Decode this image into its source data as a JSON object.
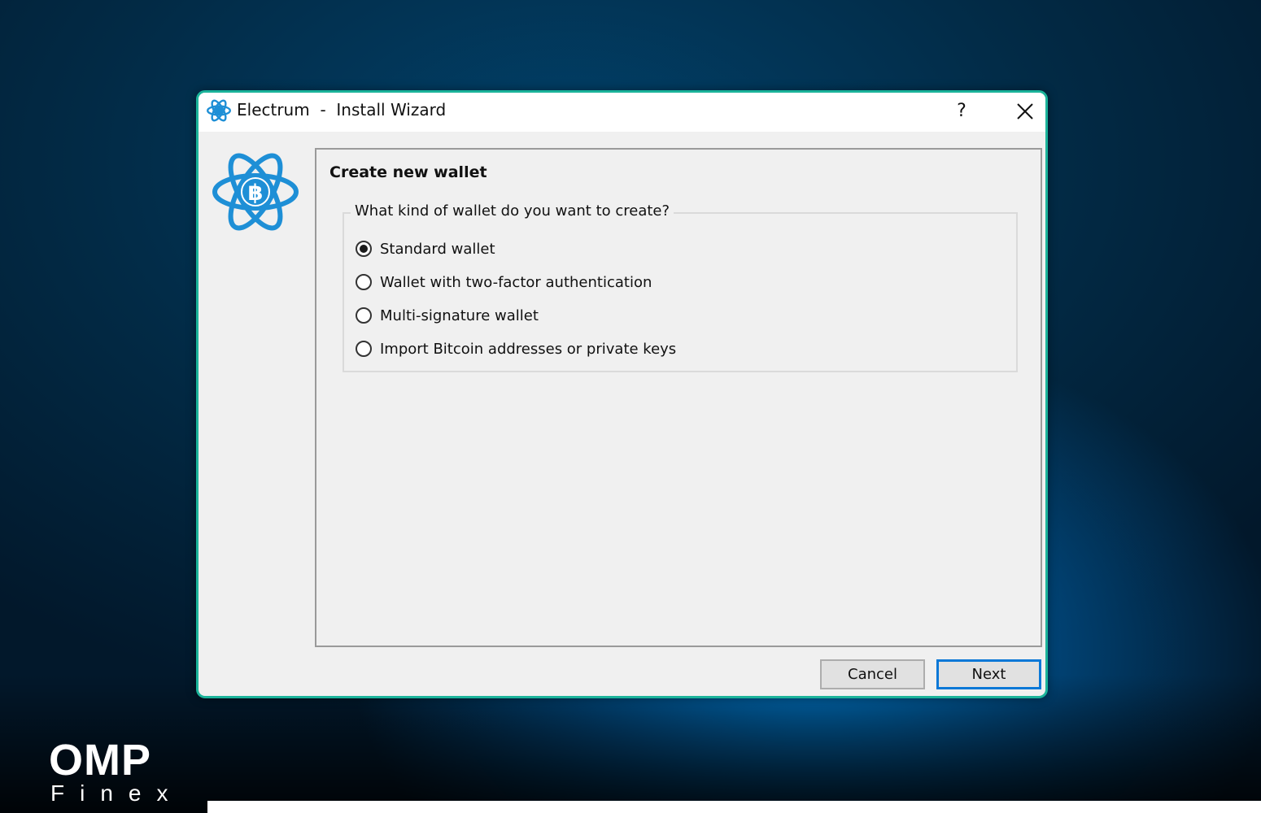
{
  "window": {
    "app_name": "Electrum",
    "separator": "-",
    "title": "Install Wizard",
    "help_label": "?"
  },
  "panel": {
    "title": "Create new wallet",
    "question": "What kind of wallet do you want to create?",
    "options": [
      {
        "label": "Standard wallet",
        "checked": true
      },
      {
        "label": "Wallet with two-factor authentication",
        "checked": false
      },
      {
        "label": "Multi-signature wallet",
        "checked": false
      },
      {
        "label": "Import Bitcoin addresses or private keys",
        "checked": false
      }
    ]
  },
  "buttons": {
    "cancel": "Cancel",
    "next": "Next"
  },
  "brand": {
    "name": "OMP",
    "sub": "Finex"
  },
  "icons": {
    "app": "electrum-logo-icon",
    "close": "close-icon"
  },
  "colors": {
    "window_border": "#1bb39a",
    "logo_blue": "#1e8fd6",
    "default_button_border": "#0a78d7"
  }
}
